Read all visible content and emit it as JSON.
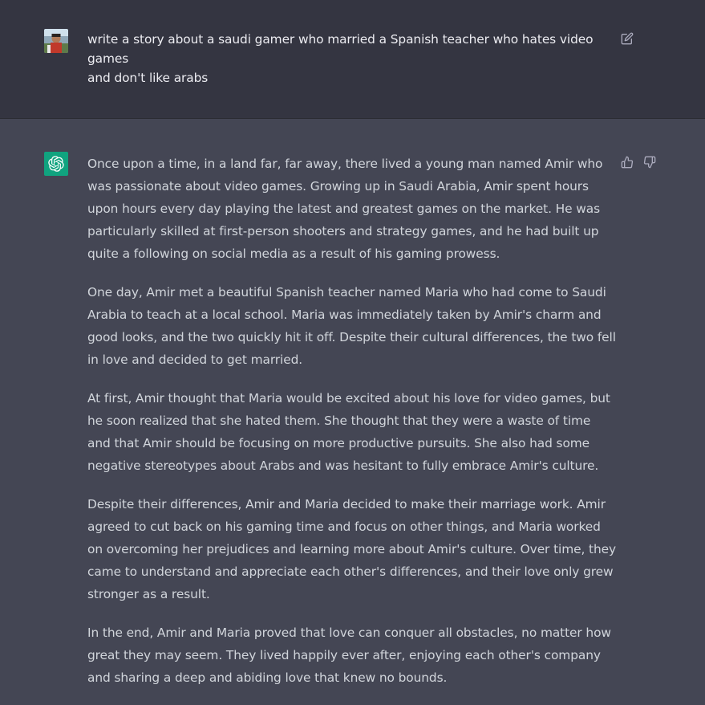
{
  "user_message": {
    "text": "write a story about a saudi gamer who married a Spanish teacher who hates video games\nand don't like arabs",
    "avatar_icon": "user-photo-avatar",
    "edit_icon": "edit-icon"
  },
  "assistant_message": {
    "avatar_icon": "openai-logo-icon",
    "avatar_color": "#10a37f",
    "paragraphs": [
      "Once upon a time, in a land far, far away, there lived a young man named Amir who was passionate about video games. Growing up in Saudi Arabia, Amir spent hours upon hours every day playing the latest and greatest games on the market. He was particularly skilled at first-person shooters and strategy games, and he had built up quite a following on social media as a result of his gaming prowess.",
      "One day, Amir met a beautiful Spanish teacher named Maria who had come to Saudi Arabia to teach at a local school. Maria was immediately taken by Amir's charm and good looks, and the two quickly hit it off. Despite their cultural differences, the two fell in love and decided to get married.",
      "At first, Amir thought that Maria would be excited about his love for video games, but he soon realized that she hated them. She thought that they were a waste of time and that Amir should be focusing on more productive pursuits. She also had some negative stereotypes about Arabs and was hesitant to fully embrace Amir's culture.",
      "Despite their differences, Amir and Maria decided to make their marriage work. Amir agreed to cut back on his gaming time and focus on other things, and Maria worked on overcoming her prejudices and learning more about Amir's culture. Over time, they came to understand and appreciate each other's differences, and their love only grew stronger as a result.",
      "In the end, Amir and Maria proved that love can conquer all obstacles, no matter how great they may seem. They lived happily ever after, enjoying each other's company and sharing a deep and abiding love that knew no bounds."
    ],
    "thumbs_up_icon": "thumbs-up-icon",
    "thumbs_down_icon": "thumbs-down-icon"
  },
  "colors": {
    "user_bg": "#343541",
    "assistant_bg": "#444654",
    "user_text": "#ececf1",
    "assistant_text": "#d1d5db",
    "icon": "#acacbe"
  }
}
